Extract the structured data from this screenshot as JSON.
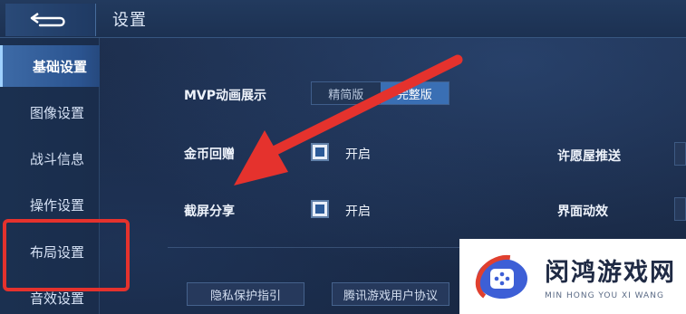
{
  "header": {
    "title": "设置"
  },
  "sidebar": {
    "items": [
      {
        "label": "基础设置",
        "active": true
      },
      {
        "label": "图像设置",
        "active": false
      },
      {
        "label": "战斗信息",
        "active": false
      },
      {
        "label": "操作设置",
        "active": false
      },
      {
        "label": "布局设置",
        "active": false
      },
      {
        "label": "音效设置",
        "active": false
      }
    ]
  },
  "settings": {
    "mvp": {
      "label": "MVP动画展示",
      "options": [
        "精简版",
        "完整版"
      ],
      "selected": "完整版"
    },
    "coin": {
      "label": "金币回赠",
      "check_label": "开启",
      "checked": true
    },
    "screenshot": {
      "label": "截屏分享",
      "check_label": "开启",
      "checked": true
    },
    "wish": {
      "label": "许愿屋推送"
    },
    "ui_anim": {
      "label": "界面动效"
    }
  },
  "links": {
    "privacy": "隐私保护指引",
    "agreement": "腾讯游戏用户协议"
  },
  "watermark": {
    "cn": "闵鸿游戏网",
    "en": "MIN HONG YOU XI WANG"
  },
  "colors": {
    "annotation": "#e5322d",
    "accent": "#3a6fb4"
  }
}
